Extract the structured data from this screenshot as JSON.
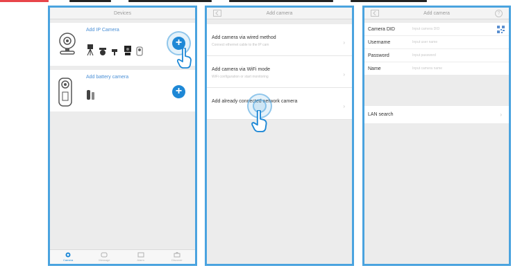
{
  "screen1": {
    "title": "Devices",
    "ip_card": {
      "title": "Add IP Camera",
      "add_symbol": "+"
    },
    "battery_card": {
      "title": "Add battery camera",
      "add_symbol": "+"
    },
    "tabs": [
      {
        "label": "Camera",
        "icon": "camera-tab-icon",
        "active": true
      },
      {
        "label": "Message",
        "icon": "message-tab-icon",
        "active": false
      },
      {
        "label": "Alarm",
        "icon": "alarm-tab-icon",
        "active": false
      },
      {
        "label": "Discover",
        "icon": "discover-tab-icon",
        "active": false
      }
    ]
  },
  "screen2": {
    "title": "Add camera",
    "items": [
      {
        "title": "Add camera via wired method",
        "subtitle": "Connect ethernet cable to the IP cam"
      },
      {
        "title": "Add camera via WiFi mode",
        "subtitle": "WiFi configuration or start monitoring"
      },
      {
        "title": "Add already connected network camera",
        "subtitle": ""
      }
    ]
  },
  "screen3": {
    "title": "Add camera",
    "fields": [
      {
        "label": "Camera DID",
        "placeholder": "Input camera DID"
      },
      {
        "label": "Username",
        "placeholder": "Input user name"
      },
      {
        "label": "Password",
        "placeholder": "Input password"
      },
      {
        "label": "Name",
        "placeholder": "Input camera name"
      }
    ],
    "lan_search": "LAN search",
    "chevron": "›"
  },
  "colors": {
    "frame": "#4aa3df",
    "accent": "#1e88d6",
    "link": "#4a8fd6",
    "highlight_red": "#e8454a"
  }
}
